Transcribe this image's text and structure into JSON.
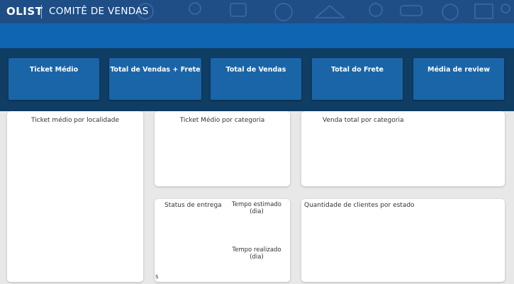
{
  "header": {
    "brand": "OLIST",
    "title": "COMITÊ DE VENDAS"
  },
  "kpis": [
    {
      "label": "Ticket Médio"
    },
    {
      "label": "Total de Vendas + Frete"
    },
    {
      "label": "Total de Vendas"
    },
    {
      "label": "Total do Frete"
    },
    {
      "label": "Média de review"
    }
  ],
  "cards": {
    "ticket_localidade": "Ticket médio por localidade",
    "ticket_categoria": "Ticket Médio por categoria",
    "venda_categoria": "Venda total por categoria",
    "status_entrega": "Status de entrega",
    "tempo_estimado": "Tempo estimado (dia)",
    "tempo_realizado": "Tempo realizado (dia)",
    "status_stray": "s",
    "clientes_estado": "Quantidade de clientes por estado"
  },
  "colors": {
    "header": "#1f4e87",
    "band": "#0e66b2",
    "kpi_strip": "#0f3d63",
    "kpi_card": "#1a65a8",
    "background": "#e8e8e8"
  }
}
